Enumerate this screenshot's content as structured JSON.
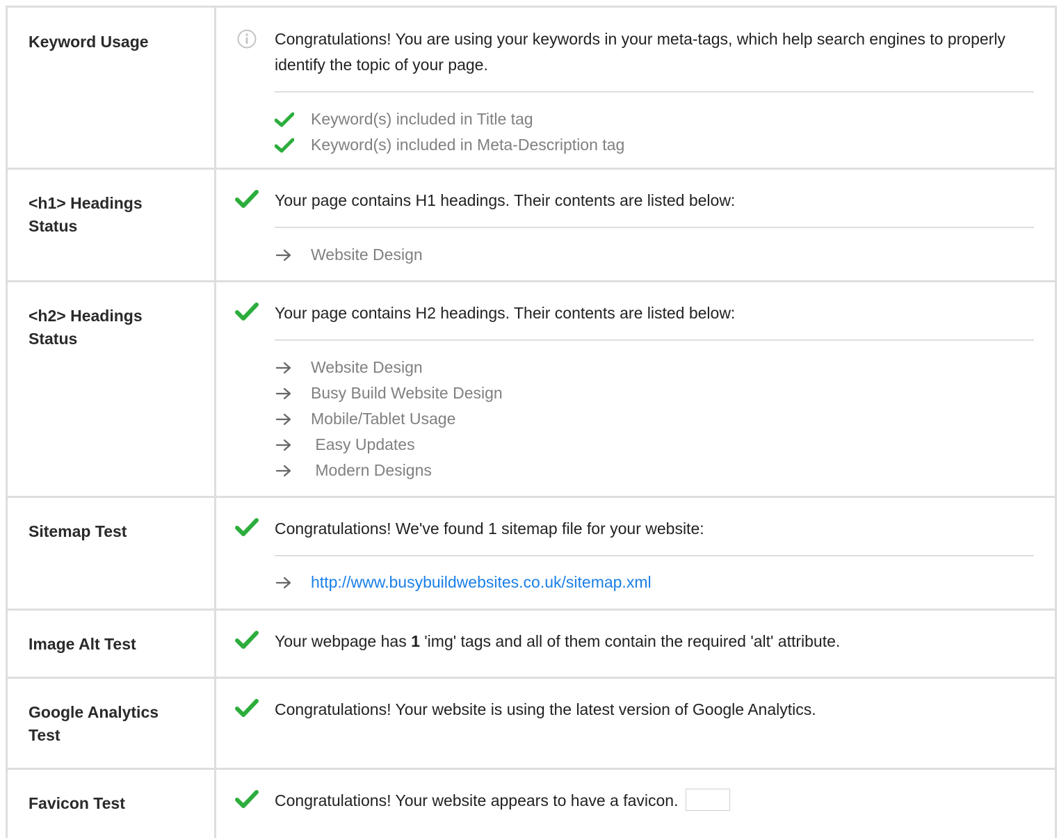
{
  "rows": [
    {
      "label": "Keyword Usage",
      "status": "info",
      "message": "Congratulations! You are using your keywords in your meta-tags, which help search engines to properly identify the topic of your page.",
      "bullet": "check",
      "items": [
        "Keyword(s) included in Title tag",
        "Keyword(s) included in Meta-Description tag"
      ]
    },
    {
      "label": "<h1> Headings Status",
      "status": "pass",
      "message": "Your page contains H1 headings. Their contents are listed below:",
      "bullet": "arrow",
      "items": [
        "Website Design"
      ]
    },
    {
      "label": "<h2> Headings Status",
      "status": "pass",
      "message": "Your page contains H2 headings. Their contents are listed below:",
      "bullet": "arrow",
      "items": [
        "Website Design",
        "Busy Build Website Design",
        "Mobile/Tablet Usage",
        " Easy Updates",
        " Modern Designs"
      ]
    },
    {
      "label": "Sitemap Test",
      "status": "pass",
      "message": "Congratulations! We've found 1 sitemap file for your website:",
      "bullet": "arrow",
      "items": [
        "http://www.busybuildwebsites.co.uk/sitemap.xml"
      ]
    },
    {
      "label": "Image Alt Test",
      "status": "pass",
      "message_before": "Your webpage has ",
      "message_bold": "1",
      "message_after": " 'img' tags and all of them contain the required 'alt' attribute."
    },
    {
      "label": "Google Analytics Test",
      "status": "pass",
      "message": "Congratulations! Your website is using the latest version of Google Analytics."
    },
    {
      "label": "Favicon Test",
      "status": "pass",
      "message": "Congratulations! Your website appears to have a favicon."
    }
  ],
  "colors": {
    "pass_green": "#2cad3c",
    "border_gray": "#dedede",
    "link_blue": "#1a7fe6",
    "muted_text": "#808080"
  },
  "icons": {
    "pass": "check-icon",
    "info": "info-circle-icon",
    "list_check": "check-icon",
    "list_arrow": "arrow-right-icon"
  }
}
